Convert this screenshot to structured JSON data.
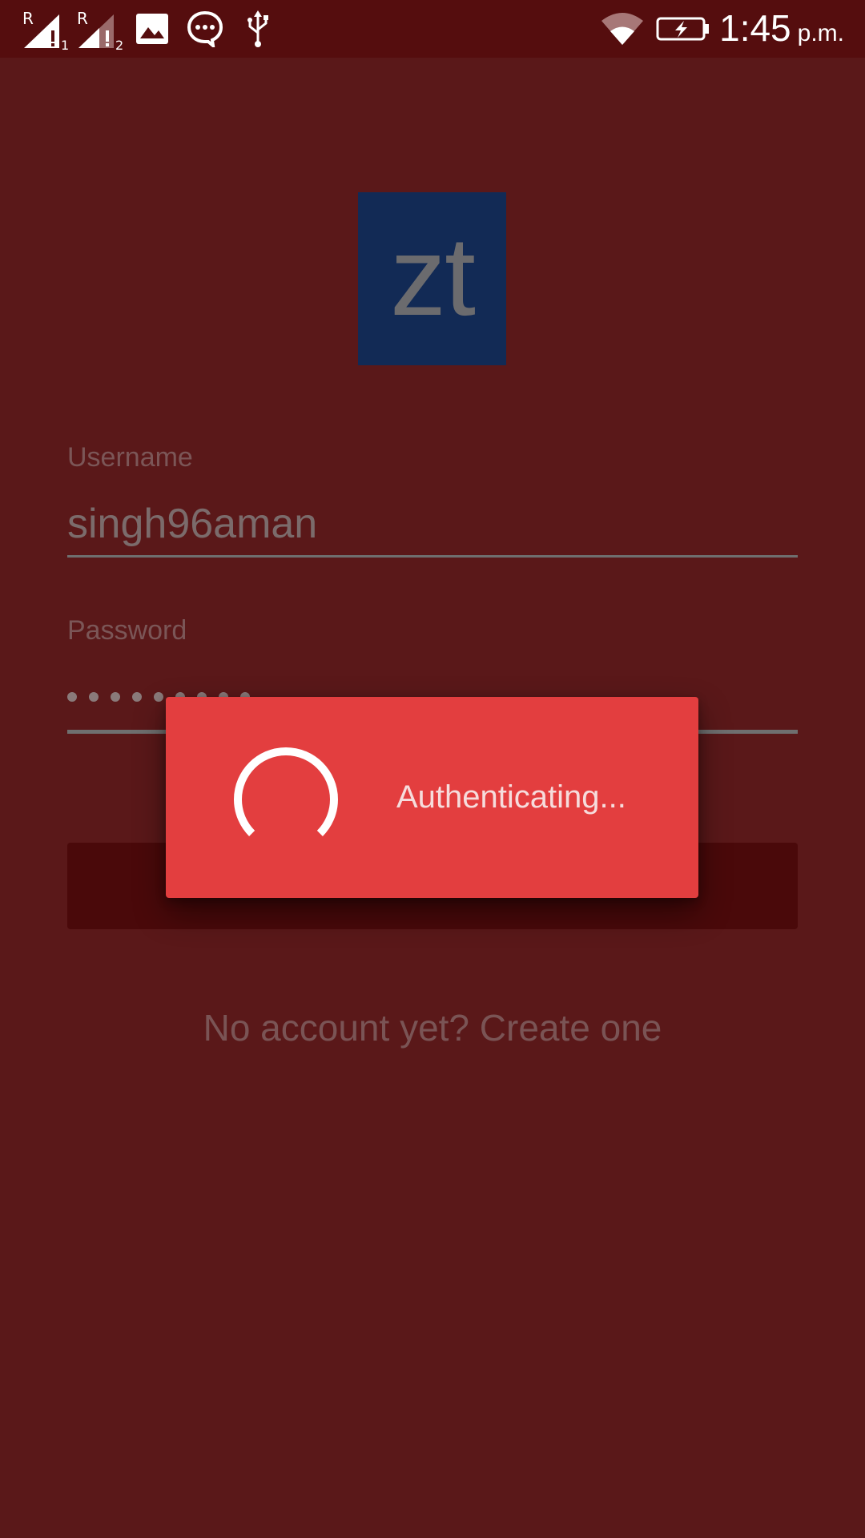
{
  "status_bar": {
    "sim1_roaming": "R",
    "sim1_index": "1",
    "sim2_roaming": "R",
    "sim2_index": "2",
    "icons": [
      "signal-sim1-icon",
      "signal-sim2-icon",
      "image-icon",
      "message-icon",
      "usb-icon",
      "wifi-icon",
      "battery-charging-icon"
    ],
    "time": "1:45",
    "ampm": "p.m."
  },
  "logo": {
    "text": "zt",
    "background": "#122a55"
  },
  "form": {
    "username_label": "Username",
    "username_value": "singh96aman",
    "password_label": "Password",
    "password_masked_count": 9
  },
  "footer": {
    "create_account": "No account yet? Create one"
  },
  "dialog": {
    "message": "Authenticating...",
    "background": "#e33e3f"
  },
  "colors": {
    "page_background": "#5a1819",
    "status_bar": "#550d0e",
    "button": "#4a090a"
  }
}
